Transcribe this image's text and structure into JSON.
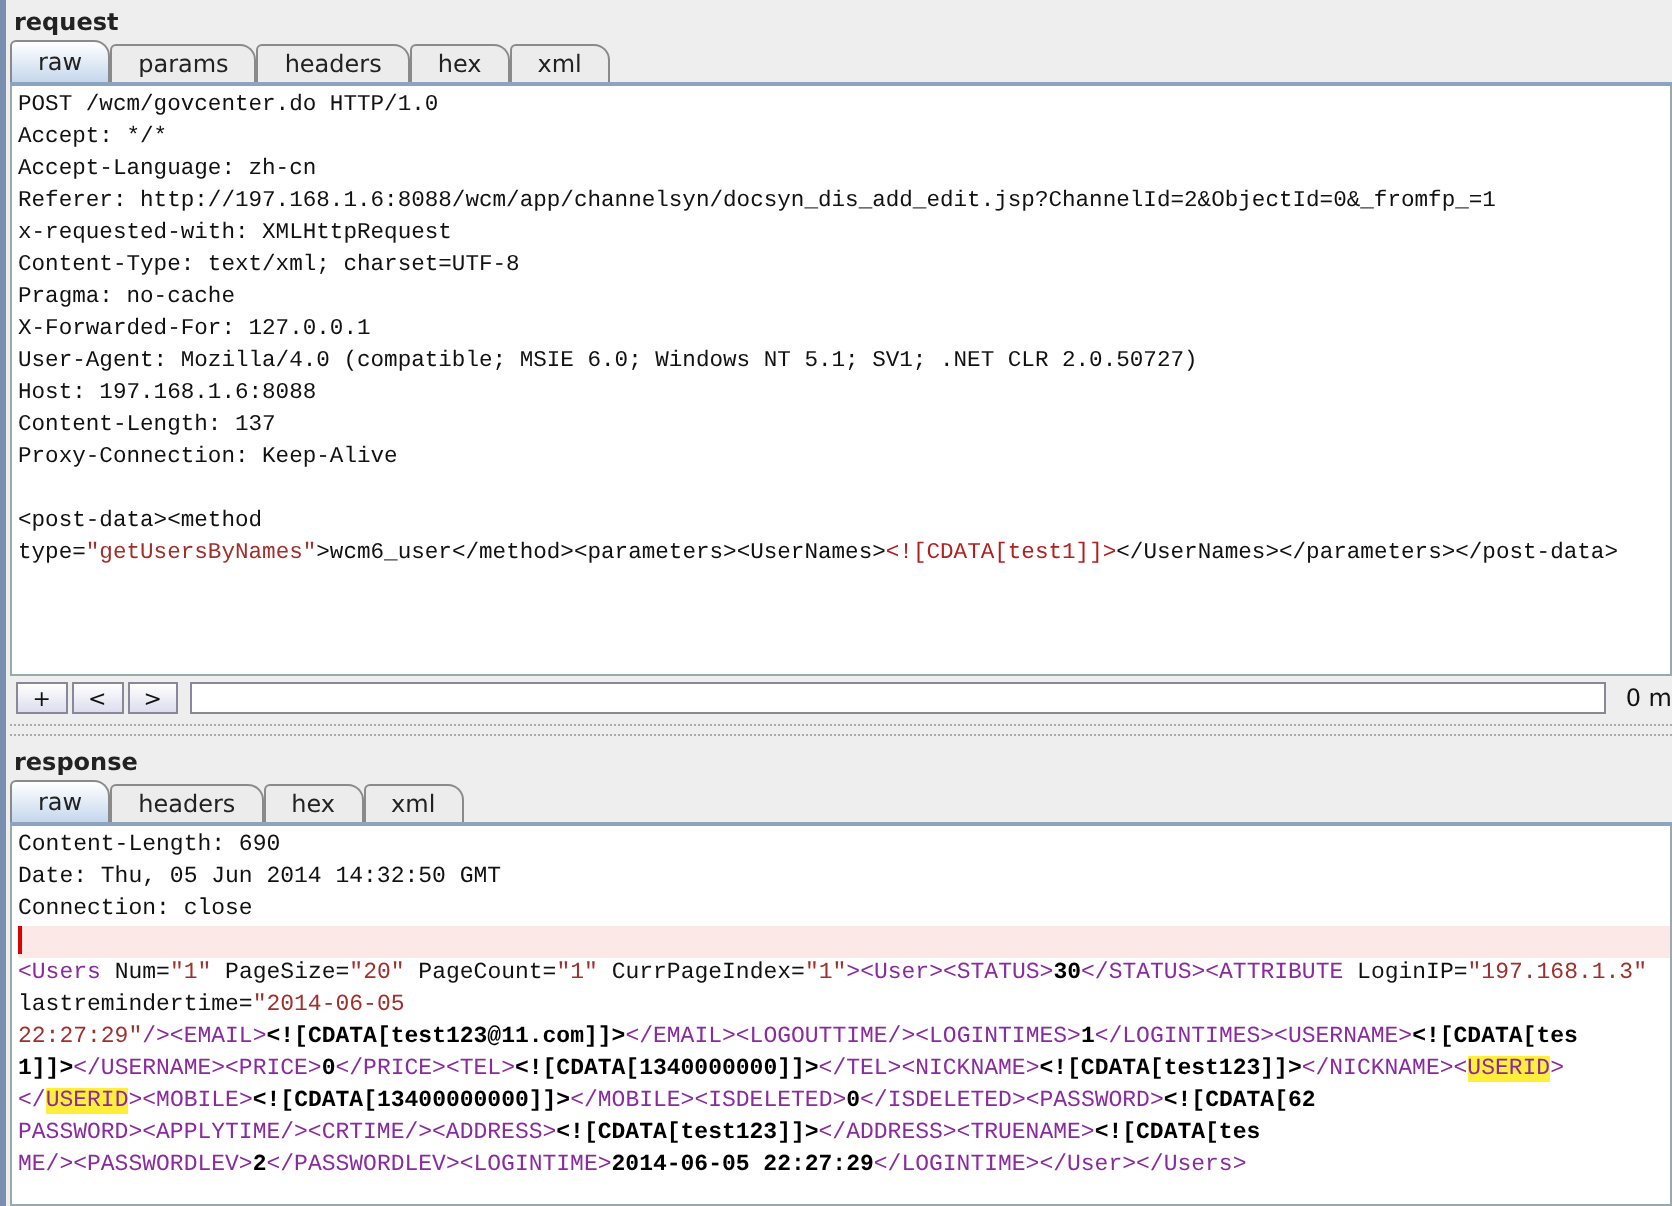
{
  "request": {
    "title": "request",
    "tabs": [
      {
        "label": "raw",
        "selected": true
      },
      {
        "label": "params",
        "selected": false
      },
      {
        "label": "headers",
        "selected": false
      },
      {
        "label": "hex",
        "selected": false
      },
      {
        "label": "xml",
        "selected": false
      }
    ],
    "lines": [
      [
        {
          "kind": "plain",
          "text": "POST /wcm/govcenter.do HTTP/1.0"
        }
      ],
      [
        {
          "kind": "plain",
          "text": "Accept: */*"
        }
      ],
      [
        {
          "kind": "plain",
          "text": "Accept-Language: zh-cn"
        }
      ],
      [
        {
          "kind": "plain",
          "text": "Referer: http://197.168.1.6:8088/wcm/app/channelsyn/docsyn_dis_add_edit.jsp?ChannelId=2&ObjectId=0&_fromfp_=1"
        }
      ],
      [
        {
          "kind": "plain",
          "text": "x-requested-with: XMLHttpRequest"
        }
      ],
      [
        {
          "kind": "plain",
          "text": "Content-Type: text/xml; charset=UTF-8"
        }
      ],
      [
        {
          "kind": "plain",
          "text": "Pragma: no-cache"
        }
      ],
      [
        {
          "kind": "plain",
          "text": "X-Forwarded-For: 127.0.0.1"
        }
      ],
      [
        {
          "kind": "plain",
          "text": "User-Agent: Mozilla/4.0 (compatible; MSIE 6.0; Windows NT 5.1; SV1; .NET CLR 2.0.50727)"
        }
      ],
      [
        {
          "kind": "plain",
          "text": "Host: 197.168.1.6:8088"
        }
      ],
      [
        {
          "kind": "plain",
          "text": "Content-Length: 137"
        }
      ],
      [
        {
          "kind": "plain",
          "text": "Proxy-Connection: Keep-Alive"
        }
      ]
    ],
    "body": [
      [
        {
          "kind": "plain",
          "text": "<post-data><method"
        }
      ],
      [
        {
          "kind": "plain",
          "text": "type="
        },
        {
          "kind": "string",
          "text": "\"getUsersByNames\""
        },
        {
          "kind": "plain",
          "text": ">wcm6_user</method><parameters><UserNames>"
        },
        {
          "kind": "cdata",
          "text": "<![CDATA[test1]]>"
        },
        {
          "kind": "plain",
          "text": "</UserNames></parameters></post-data>"
        }
      ]
    ],
    "toolbar": {
      "buttons": [
        "+",
        "<",
        ">"
      ],
      "matches": "0 m"
    }
  },
  "response": {
    "title": "response",
    "tabs": [
      {
        "label": "raw",
        "selected": true
      },
      {
        "label": "headers",
        "selected": false
      },
      {
        "label": "hex",
        "selected": false
      },
      {
        "label": "xml",
        "selected": false
      }
    ],
    "lines": [
      [
        {
          "kind": "plain",
          "text": "Content-Length: 690"
        }
      ],
      [
        {
          "kind": "plain",
          "text": "Date: Thu, 05 Jun 2014 14:32:50 GMT"
        }
      ],
      [
        {
          "kind": "plain",
          "text": "Connection: close"
        }
      ],
      [
        {
          "kind": "cursor"
        }
      ],
      [
        {
          "kind": "tag",
          "text": "<Users"
        },
        {
          "kind": "plain",
          "text": " Num="
        },
        {
          "kind": "string",
          "text": "\"1\""
        },
        {
          "kind": "plain",
          "text": " PageSize="
        },
        {
          "kind": "string",
          "text": "\"20\""
        },
        {
          "kind": "plain",
          "text": " PageCount="
        },
        {
          "kind": "string",
          "text": "\"1\""
        },
        {
          "kind": "plain",
          "text": " CurrPageIndex="
        },
        {
          "kind": "string",
          "text": "\"1\""
        },
        {
          "kind": "tag",
          "text": "><User><STATUS>"
        },
        {
          "kind": "bold",
          "text": "30"
        },
        {
          "kind": "tag",
          "text": "</STATUS><ATTRIBUTE"
        },
        {
          "kind": "plain",
          "text": " LoginIP="
        },
        {
          "kind": "string",
          "text": "\"197.168.1.3\""
        }
      ],
      [
        {
          "kind": "plain",
          "text": "lastremindertime="
        },
        {
          "kind": "string",
          "text": "\"2014-06-05"
        }
      ],
      [
        {
          "kind": "string",
          "text": "22:27:29\""
        },
        {
          "kind": "tag",
          "text": "/><EMAIL>"
        },
        {
          "kind": "bold",
          "text": "<![CDATA[test123@11.com]]>"
        },
        {
          "kind": "tag",
          "text": "</EMAIL><LOGOUTTIME/><LOGINTIMES>"
        },
        {
          "kind": "bold",
          "text": "1"
        },
        {
          "kind": "tag",
          "text": "</LOGINTIMES><USERNAME>"
        },
        {
          "kind": "bold",
          "text": "<![CDATA[tes"
        }
      ],
      [
        {
          "kind": "bold",
          "text": "1]]>"
        },
        {
          "kind": "tag",
          "text": "</USERNAME><PRICE>"
        },
        {
          "kind": "bold",
          "text": "0"
        },
        {
          "kind": "tag",
          "text": "</PRICE><TEL>"
        },
        {
          "kind": "bold",
          "text": "<![CDATA[1340000000]]>"
        },
        {
          "kind": "tag",
          "text": "</TEL><NICKNAME>"
        },
        {
          "kind": "bold",
          "text": "<![CDATA[test123]]>"
        },
        {
          "kind": "tag",
          "text": "</NICKNAME><"
        },
        {
          "kind": "highlight",
          "text": "USERID"
        },
        {
          "kind": "tag",
          "text": ">"
        }
      ],
      [
        {
          "kind": "tag",
          "text": "</"
        },
        {
          "kind": "highlight",
          "text": "USERID"
        },
        {
          "kind": "tag",
          "text": "><MOBILE>"
        },
        {
          "kind": "bold",
          "text": "<![CDATA[13400000000]]>"
        },
        {
          "kind": "tag",
          "text": "</MOBILE><ISDELETED>"
        },
        {
          "kind": "bold",
          "text": "0"
        },
        {
          "kind": "tag",
          "text": "</ISDELETED><PASSWORD>"
        },
        {
          "kind": "bold",
          "text": "<![CDATA[62"
        }
      ],
      [
        {
          "kind": "tag",
          "text": "PASSWORD><APPLYTIME/><CRTIME/><ADDRESS>"
        },
        {
          "kind": "bold",
          "text": "<![CDATA[test123]]>"
        },
        {
          "kind": "tag",
          "text": "</ADDRESS><TRUENAME>"
        },
        {
          "kind": "bold",
          "text": "<![CDATA[tes"
        }
      ],
      [
        {
          "kind": "tag",
          "text": "ME/><PASSWORDLEV>"
        },
        {
          "kind": "bold",
          "text": "2"
        },
        {
          "kind": "tag",
          "text": "</PASSWORDLEV><LOGINTIME>"
        },
        {
          "kind": "bold",
          "text": "2014-06-05 22:27:29"
        },
        {
          "kind": "tag",
          "text": "</LOGINTIME></User></Users>"
        }
      ]
    ]
  }
}
